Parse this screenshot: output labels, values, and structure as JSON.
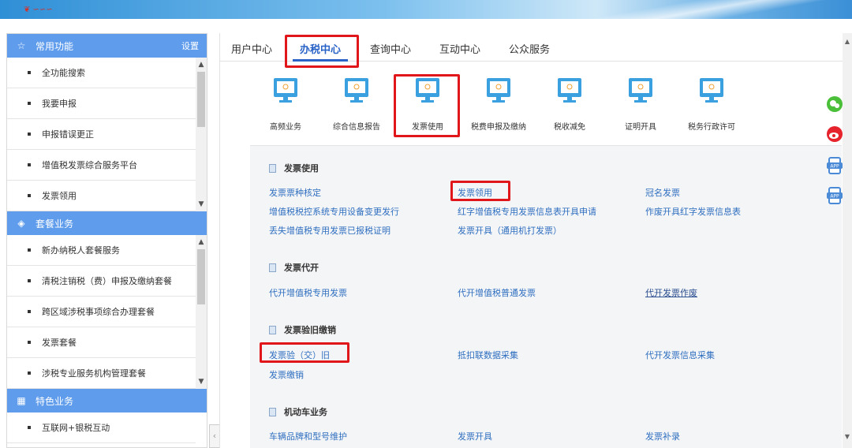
{
  "sidebar": {
    "common": {
      "title": "常用功能",
      "settings": "设置",
      "items": [
        "全功能搜索",
        "我要申报",
        "申报错误更正",
        "增值税发票综合服务平台",
        "发票领用"
      ]
    },
    "package": {
      "title": "套餐业务",
      "items": [
        "新办纳税人套餐服务",
        "清税注销税（费）申报及缴纳套餐",
        "跨区域涉税事项综合办理套餐",
        "发票套餐",
        "涉税专业服务机构管理套餐"
      ]
    },
    "special": {
      "title": "特色业务",
      "items": [
        "互联网+银税互动"
      ]
    }
  },
  "tabs": [
    "用户中心",
    "办税中心",
    "查询中心",
    "互动中心",
    "公众服务"
  ],
  "icons": [
    "高频业务",
    "综合信息报告",
    "发票使用",
    "税费申报及缴纳",
    "税收减免",
    "证明开具",
    "税务行政许可"
  ],
  "groups": {
    "g1": {
      "title": "发票使用",
      "links": [
        "发票票种核定",
        "发票领用",
        "冠名发票",
        "增值税税控系统专用设备变更发行",
        "红字增值税专用发票信息表开具申请",
        "作废开具红字发票信息表",
        "丢失增值税专用发票已报税证明",
        "发票开具（通用机打发票）"
      ]
    },
    "g2": {
      "title": "发票代开",
      "links": [
        "代开增值税专用发票",
        "代开增值税普通发票",
        "代开发票作废"
      ]
    },
    "g3": {
      "title": "发票验旧缴销",
      "links": [
        "发票验（交）旧",
        "抵扣联数据采集",
        "代开发票信息采集",
        "发票缴销"
      ]
    },
    "g4": {
      "title": "机动车业务",
      "links": [
        "车辆品牌和型号维护",
        "发票开具",
        "发票补录"
      ]
    }
  },
  "colors": {
    "accent": "#2a63c7",
    "highlight": "#e0161b",
    "sidebar_header": "#5f9cec",
    "link": "#2f6fc0"
  }
}
